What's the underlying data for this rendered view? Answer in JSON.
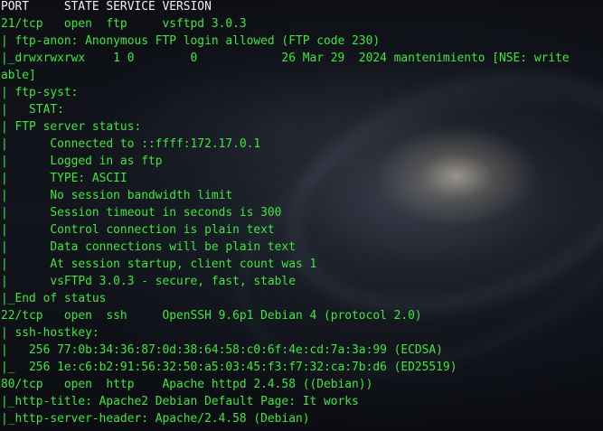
{
  "terminal": {
    "header": "PORT     STATE SERVICE VERSION",
    "lines": [
      "21/tcp   open  ftp     vsftpd 3.0.3",
      "| ftp-anon: Anonymous FTP login allowed (FTP code 230)",
      "|_drwxrwxrwx    1 0        0            26 Mar 29  2024 mantenimiento [NSE: write",
      "able]",
      "| ftp-syst:",
      "|   STAT:",
      "| FTP server status:",
      "|      Connected to ::ffff:172.17.0.1",
      "|      Logged in as ftp",
      "|      TYPE: ASCII",
      "|      No session bandwidth limit",
      "|      Session timeout in seconds is 300",
      "|      Control connection is plain text",
      "|      Data connections will be plain text",
      "|      At session startup, client count was 1",
      "|      vsFTPd 3.0.3 - secure, fast, stable",
      "|_End of status",
      "22/tcp   open  ssh     OpenSSH 9.6p1 Debian 4 (protocol 2.0)",
      "| ssh-hostkey:",
      "|   256 77:0b:34:36:87:0d:38:64:58:c0:6f:4e:cd:7a:3a:99 (ECDSA)",
      "|_  256 1e:c6:b2:91:56:32:50:a5:03:45:f3:f7:32:ca:7b:d6 (ED25519)",
      "80/tcp   open  http    Apache httpd 2.4.58 ((Debian))",
      "|_http-title: Apache2 Debian Default Page: It works",
      "|_http-server-header: Apache/2.4.58 (Debian)"
    ]
  },
  "colors": {
    "text": "#3ee63e",
    "header": "#f0f0f0",
    "background": "#0b0d12"
  }
}
